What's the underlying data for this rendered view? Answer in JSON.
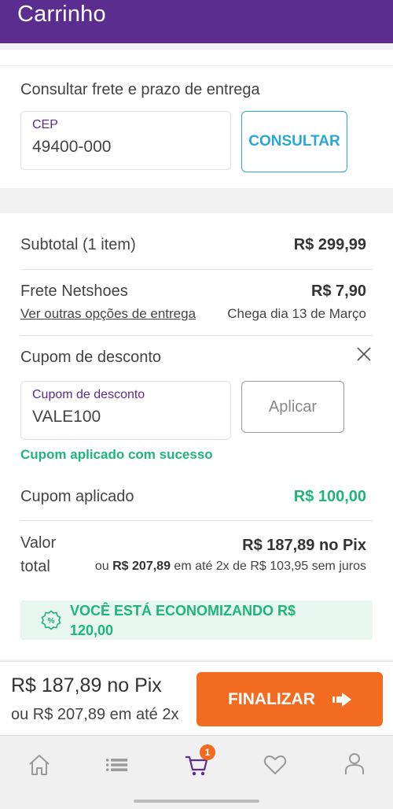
{
  "header": {
    "title": "Carrinho"
  },
  "frete": {
    "title": "Consultar frete e prazo de entrega",
    "cep_label": "CEP",
    "cep_value": "49400-000",
    "consultar_label": "CONSULTAR"
  },
  "summary": {
    "subtotal_label": "Subtotal (1 item)",
    "subtotal_value": "R$ 299,99",
    "frete_label": "Frete Netshoes",
    "frete_value": "R$ 7,90",
    "frete_link": "Ver outras opções de entrega",
    "delivery_text": "Chega dia 13 de Março",
    "cupom_title": "Cupom de desconto",
    "cupom_field_label": "Cupom de desconto",
    "cupom_value": "VALE100",
    "aplicar_label": "Aplicar",
    "cupom_success": "Cupom aplicado com sucesso",
    "cupom_aplicado_label": "Cupom aplicado",
    "cupom_aplicado_value": "R$ 100,00",
    "total_label_1": "Valor",
    "total_label_2": "total",
    "total_pix": "R$ 187,89 no Pix",
    "total_inst_prefix": "ou",
    "total_inst_value": "R$ 207,89",
    "total_inst_suffix": "em até 2x de R$ 103,95 sem juros",
    "saving_text": "VOCÊ ESTÁ ECONOMIZANDO R$ 120,00"
  },
  "footer": {
    "pix_price": "R$ 187,89 no Pix",
    "installments": "ou R$ 207,89 em até 2x",
    "finalizar_label": "FINALIZAR"
  },
  "nav": {
    "items": [
      "home-icon",
      "menu-icon",
      "cart-icon",
      "heart-icon",
      "user-icon"
    ],
    "cart_badge": "1",
    "active_color": "#5c2d91",
    "inactive_color": "#9a9a9a"
  },
  "colors": {
    "brand": "#5c2d91",
    "accent": "#f26b21",
    "link": "#29a7d6",
    "success": "#1fb57a"
  }
}
